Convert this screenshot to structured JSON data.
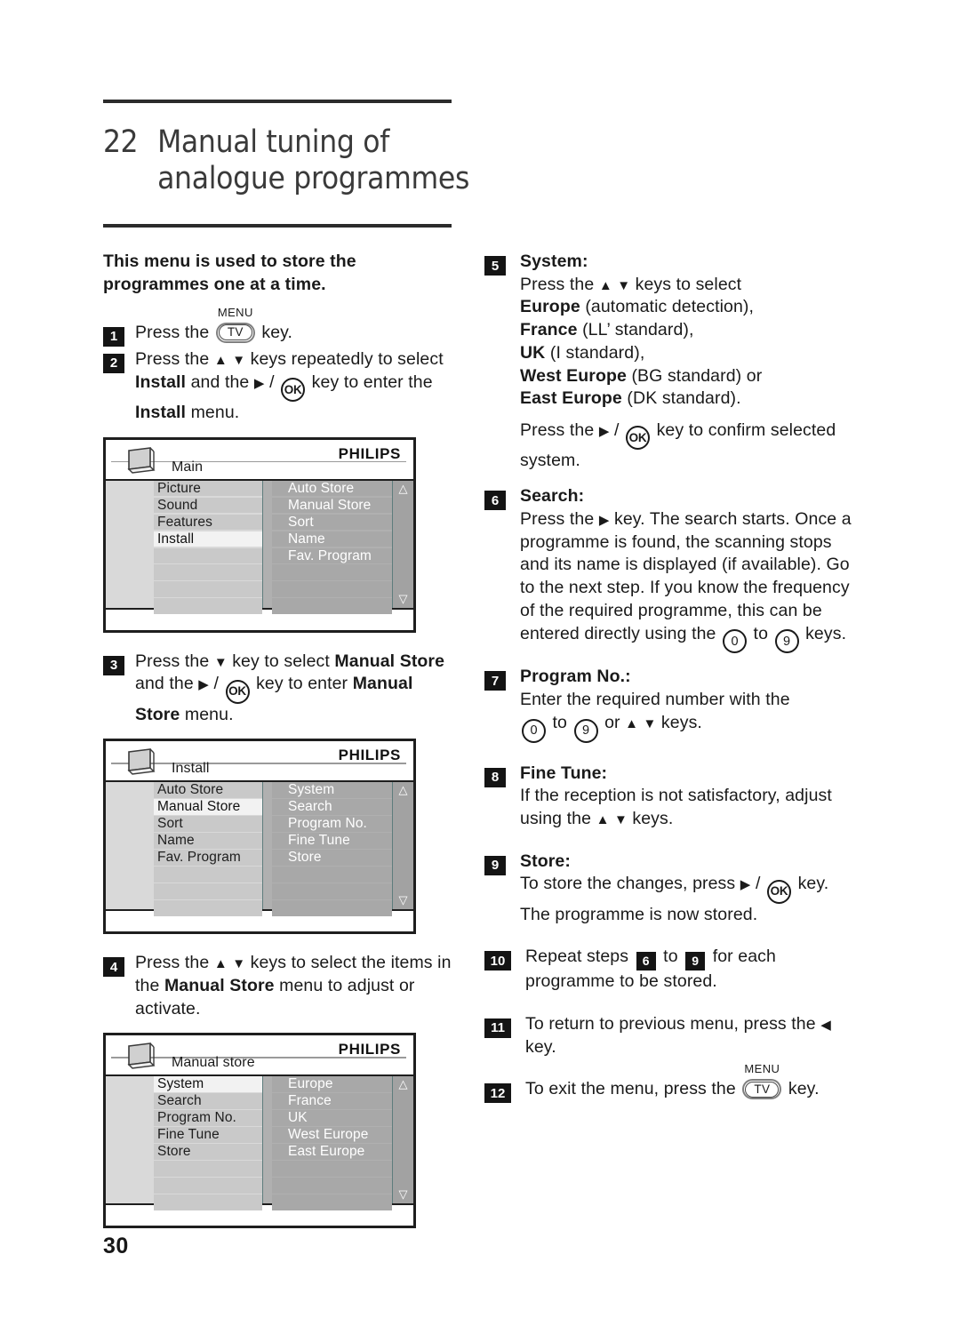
{
  "chapter": {
    "number": "22",
    "title_line1": "Manual tuning of",
    "title_line2": "analogue programmes"
  },
  "page_number": "30",
  "left_column": {
    "intro": "This menu is used to store the programmes one at a time.",
    "step1": {
      "num": "1",
      "t1": "Press the",
      "key": "TV",
      "key_cap": "MENU",
      "t2": "key."
    },
    "step2": {
      "num": "2",
      "t1": "Press the",
      "up": "▲",
      "down": "▼",
      "t2": "keys repeatedly to select",
      "b1": "Install",
      "t3": "and the",
      "right": "▶",
      "slash": "/",
      "ok": "OK",
      "t4": "key to enter the",
      "b2": "Install",
      "t5": "menu."
    },
    "step3": {
      "num": "3",
      "t1": "Press the",
      "down": "▼",
      "t2": "key to select",
      "b1": "Manual Store",
      "t3": "and the",
      "right": "▶",
      "slash": "/",
      "ok": "OK",
      "t4": "key to enter",
      "b2": "Manual Store",
      "t5": "menu."
    },
    "step4": {
      "num": "4",
      "t1": "Press the",
      "up": "▲",
      "down": "▼",
      "t2": "keys to select the items in the",
      "b1": "Manual Store",
      "t3": "menu to adjust or activate."
    },
    "osd1": {
      "brand": "PHILIPS",
      "crumb": "Main",
      "left_items": [
        "Picture",
        "Sound",
        "Features",
        "Install"
      ],
      "left_selected": "Install",
      "right_items": [
        "Auto Store",
        "Manual Store",
        "Sort",
        "Name",
        "Fav. Program"
      ],
      "scroll_up": "△",
      "scroll_down": "▽"
    },
    "osd2": {
      "brand": "PHILIPS",
      "crumb": "Install",
      "left_items": [
        "Auto Store",
        "Manual Store",
        "Sort",
        "Name",
        "Fav. Program"
      ],
      "left_selected": "Manual Store",
      "right_items": [
        "System",
        "Search",
        "Program No.",
        "Fine Tune",
        "Store"
      ],
      "scroll_up": "△",
      "scroll_down": "▽"
    },
    "osd3": {
      "brand": "PHILIPS",
      "crumb": "Manual store",
      "left_items": [
        "System",
        "Search",
        "Program No.",
        "Fine Tune",
        "Store"
      ],
      "left_selected": "System",
      "right_items": [
        "Europe",
        "France",
        "UK",
        "West Europe",
        "East Europe"
      ],
      "scroll_up": "△",
      "scroll_down": "▽"
    }
  },
  "right_column": {
    "step5": {
      "num": "5",
      "head": "System:",
      "t1": "Press the",
      "up": "▲",
      "down": "▼",
      "t2": "keys to select",
      "o1b": "Europe",
      "o1t": "(automatic detection),",
      "o2b": "France",
      "o2t": "(LL’ standard),",
      "o3b": "UK",
      "o3t": "(I standard),",
      "o4b": "West Europe",
      "o4t": "(BG standard)  or",
      "o5b": "East Europe",
      "o5t": "(DK standard).",
      "t3": "Press the",
      "right": "▶",
      "slash": "/",
      "ok": "OK",
      "t4": "key to confirm selected system."
    },
    "step6": {
      "num": "6",
      "head": "Search:",
      "t1": "Press the",
      "right": "▶",
      "t2": "key. The search starts. Once a programme is found, the scanning stops and its name is displayed (if available). Go to the next step. If you know the frequency of the required programme, this can be entered directly using the",
      "k0": "0",
      "to": "to",
      "k9": "9",
      "t3": "keys."
    },
    "step7": {
      "num": "7",
      "head": "Program No.:",
      "t1": "Enter the required number with the",
      "k0": "0",
      "to": "to",
      "k9": "9",
      "or": "or",
      "up": "▲",
      "down": "▼",
      "t2": "keys."
    },
    "step8": {
      "num": "8",
      "head": "Fine Tune:",
      "t1": "If the reception is not satisfactory, adjust using the",
      "up": "▲",
      "down": "▼",
      "t2": "keys."
    },
    "step9": {
      "num": "9",
      "head": "Store:",
      "t1": "To store the changes, press",
      "right": "▶",
      "slash": "/",
      "ok": "OK",
      "t2": "key. The programme is now stored."
    },
    "step10": {
      "num": "10",
      "t1": "Repeat steps",
      "n1": "6",
      "to": "to",
      "n2": "9",
      "t2": "for each programme to be stored."
    },
    "step11": {
      "num": "11",
      "t1": "To return to previous menu, press the",
      "left": "◀",
      "t2": "key."
    },
    "step12": {
      "num": "12",
      "t1": "To exit the menu, press the",
      "key": "TV",
      "key_cap": "MENU",
      "t2": "key."
    }
  }
}
